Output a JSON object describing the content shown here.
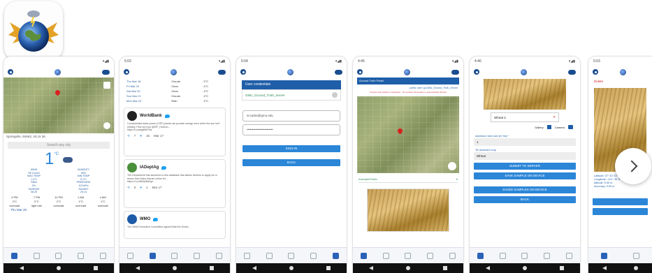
{
  "status_bar": {
    "phone1_time": "",
    "phone2_time": "5:03",
    "phone3_time": "5:04",
    "phone4_time": "4:45",
    "phone5_time": "4:46",
    "phone6_time": "5:03"
  },
  "phone1": {
    "location_line": "Springville, 84663, 40.15 36",
    "search_placeholder": "Search any city",
    "temperature": "1",
    "temp_unit": "°C",
    "stats": [
      {
        "label": "WIND",
        "value": "SE 5 km/h"
      },
      {
        "label": "HUMIDITY",
        "value": "95%"
      },
      {
        "label": "MAX TEMP",
        "value": "1.4°C"
      },
      {
        "label": "MIN TEMP",
        "value": "0.1°C"
      },
      {
        "label": "RAIN",
        "value": "0%"
      },
      {
        "label": "PRESSURE",
        "value": "1011hPa"
      },
      {
        "label": "SUNRISE",
        "value": "06:25"
      },
      {
        "label": "SUNSET",
        "value": "20:14"
      }
    ],
    "hours": [
      "4 PM",
      "7 PM",
      "10 PM",
      "1 AM",
      "4 AM"
    ],
    "hour_temps": [
      "2°C",
      "2°C",
      "2°C",
      "1°C",
      "1°C"
    ],
    "hour_cond": [
      "overcast",
      "light rain",
      "overcast",
      "overcast",
      "overcast"
    ],
    "forecast_day": "Thu Mar 28"
  },
  "phone2": {
    "forecast": [
      {
        "day": "Thu Mar 18",
        "cond": "Clouds",
        "temp": "2°C"
      },
      {
        "day": "Fri Mar 19",
        "cond": "Clear",
        "temp": "4°C"
      },
      {
        "day": "Sat Mar 20",
        "cond": "Clear",
        "temp": "4°C"
      },
      {
        "day": "Sun Mar 21",
        "cond": "Clouds",
        "temp": "4°C"
      },
      {
        "day": "Mon Mar 22",
        "cond": "Rain",
        "temp": "2°C"
      }
    ],
    "tweets": [
      {
        "author": "WorldBank",
        "text": "Concentrated solar power (CSP) plants can provide energy even when the sun isn't shining. Find out how @EIF_Horizon...",
        "link": "https://t.co/ptgfKM7Ns",
        "retweets": "7",
        "likes": "16",
        "date": "Mar 17"
      },
      {
        "author": "IADeptAg",
        "text": "The Department has launched a new database that allows farmers to apply for or renew their Dairy license online for...",
        "link": "https://t.co/NrBjnNaFgn",
        "retweets": "0",
        "likes": "1",
        "date": "Mar 17"
      },
      {
        "author": "WMO",
        "text": "The WMO Executive Committee agreed that the Greek...",
        "link": "",
        "retweets": "",
        "likes": "",
        "date": ""
      }
    ]
  },
  "phone3": {
    "header": "User credentials",
    "server": "GMU_Ground_Truth_Server",
    "email": "sccadra@gmu.edu",
    "password_mask": "••••••••••••••••••••••••",
    "sign_in": "SIGN IN",
    "back": "BACK"
  },
  "phone4": {
    "header": "Ground Truth Panel",
    "public_user": "public user: gi-GMU_Ground_Truth_Server",
    "notice": "Sample and weather coordinates · the location information is automatically fetched",
    "mode": "example/Public"
  },
  "phone5": {
    "crop": "Wheat 2",
    "gallery": "Gallery",
    "camera": "Camera",
    "size_label": "maximum farm size (In Ha) *",
    "size_value": "1",
    "crop_label": "Tel dominant crop",
    "crop_value": "Wheat",
    "submit": "SUBMIT TO SERVER",
    "save": "SAVE SAMPLE ON DEVICE",
    "saved": "SAVED SAMPLES ON DEVICE",
    "back": "BACK"
  },
  "phone6": {
    "delete": "Delete",
    "lat": "Latitude: 37° 43' 33\" N",
    "lon": "Longitude: -121° 35' 8\"",
    "alt": "Altitude: 5.00 m",
    "acc": "Accuracy: 0.00 m"
  },
  "colors": {
    "accent": "#2b86d8",
    "brand": "#1a4d8f",
    "pin": "#d82020"
  }
}
